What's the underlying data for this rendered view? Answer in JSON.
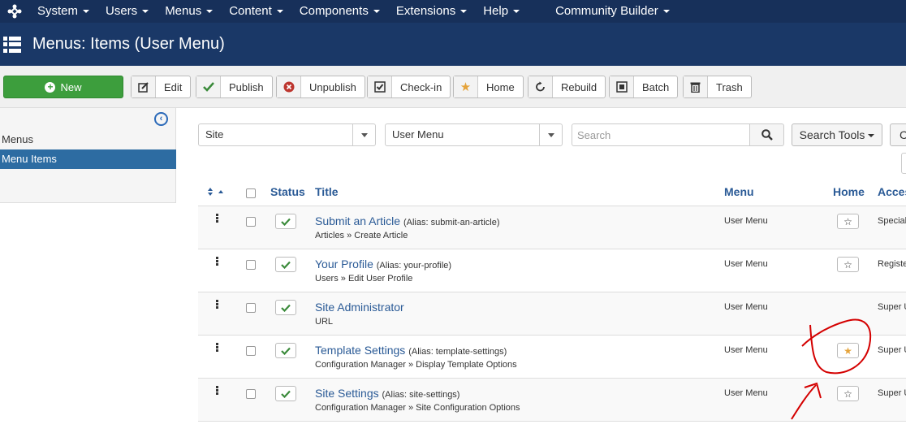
{
  "topnav": {
    "items": [
      "System",
      "Users",
      "Menus",
      "Content",
      "Components",
      "Extensions",
      "Help",
      "Community Builder"
    ]
  },
  "header": {
    "title": "Menus: Items (User Menu)"
  },
  "toolbar": {
    "new_label": "New",
    "edit_label": "Edit",
    "publish_label": "Publish",
    "unpublish_label": "Unpublish",
    "checkin_label": "Check-in",
    "home_label": "Home",
    "rebuild_label": "Rebuild",
    "batch_label": "Batch",
    "trash_label": "Trash"
  },
  "sidebar": {
    "items": [
      {
        "label": "Menus",
        "active": false
      },
      {
        "label": "Menu Items",
        "active": true
      }
    ]
  },
  "filters": {
    "client_value": "Site",
    "menu_value": "User Menu",
    "search_placeholder": "Search",
    "search_tools_label": "Search Tools",
    "clear_label": "C"
  },
  "table": {
    "headers": {
      "status": "Status",
      "title": "Title",
      "menu": "Menu",
      "home": "Home",
      "access": "Acces"
    },
    "rows": [
      {
        "title": "Submit an Article",
        "alias": "(Alias: submit-an-article)",
        "sub": "Articles » Create Article",
        "menu": "User Menu",
        "home": "unset",
        "access": "Special"
      },
      {
        "title": "Your Profile",
        "alias": "(Alias: your-profile)",
        "sub": "Users » Edit User Profile",
        "menu": "User Menu",
        "home": "unset",
        "access": "Registe"
      },
      {
        "title": "Site Administrator",
        "alias": "",
        "sub": "URL",
        "menu": "User Menu",
        "home": "none",
        "access": "Super U"
      },
      {
        "title": "Template Settings",
        "alias": "(Alias: template-settings)",
        "sub": "Configuration Manager » Display Template Options",
        "menu": "User Menu",
        "home": "default",
        "access": "Super U"
      },
      {
        "title": "Site Settings",
        "alias": "(Alias: site-settings)",
        "sub": "Configuration Manager » Site Configuration Options",
        "menu": "User Menu",
        "home": "unset",
        "access": "Super U"
      }
    ]
  },
  "colors": {
    "nav": "#17305a",
    "header": "#1a3867",
    "accent": "#2d6ca2",
    "new_button": "#3d9e3d",
    "check": "#3a8a3a",
    "star_active": "#e5a33a",
    "annotation": "#d40000"
  }
}
